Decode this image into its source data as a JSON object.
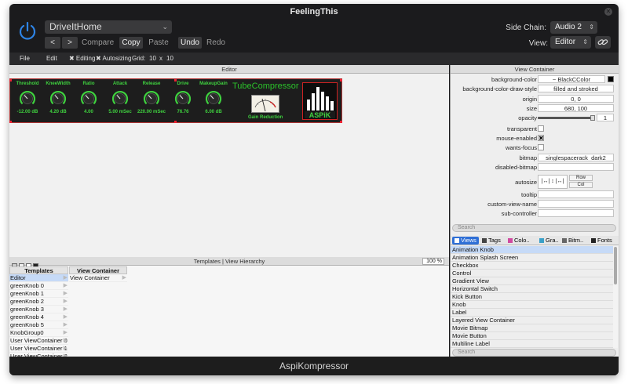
{
  "window_title": "FeelingThis",
  "preset": {
    "name": "DriveItHome"
  },
  "toolbar": {
    "back": "<",
    "forward": ">",
    "compare": "Compare",
    "copy": "Copy",
    "paste": "Paste",
    "undo": "Undo",
    "redo": "Redo",
    "side_chain_label": "Side Chain:",
    "side_chain_value": "Audio 2",
    "view_label": "View:",
    "view_value": "Editor"
  },
  "edit_bar": {
    "file": "File",
    "edit": "Edit",
    "editing": "✖ Editing",
    "autosizing": "✖ Autosizing",
    "grid_label": "Grid:",
    "grid_x": "10",
    "grid_sep": "x",
    "grid_y": "10"
  },
  "editor": {
    "title": "Editor",
    "plugin": {
      "name": "TubeCompressor",
      "knobs": [
        {
          "label": "Threshold",
          "value": "-12.00 dB"
        },
        {
          "label": "KneeWidth",
          "value": "4.20 dB"
        },
        {
          "label": "Ratio",
          "value": "4.00"
        },
        {
          "label": "Attack",
          "value": "5.00 mSec"
        },
        {
          "label": "Release",
          "value": "220.00 mSec"
        },
        {
          "label": "Drive",
          "value": "76.76"
        },
        {
          "label": "MakeupGain",
          "value": "6.00 dB"
        }
      ],
      "meter_label": "Gain Reduction",
      "logo_text": "ASPiK"
    }
  },
  "templates": {
    "title": "Templates | View Hierarchy",
    "zoom": "100 %",
    "col1_header": "Templates",
    "col2_header": "View Container",
    "items": [
      "Editor",
      "greenKnob 0",
      "greenKnob 1",
      "greenKnob 2",
      "greenKnob 3",
      "greenKnob 4",
      "greenKnob 5",
      "KnobGroup0",
      "User ViewContainer 0",
      "User ViewContainer 1",
      "User ViewContainer 2"
    ],
    "hierarchy": [
      "View Container"
    ]
  },
  "view_container": {
    "title": "View Container",
    "attributes": [
      {
        "label": "background-color",
        "value": "~ BlackCColor",
        "kind": "color"
      },
      {
        "label": "background-color-draw-style",
        "value": "filled and stroked",
        "kind": "text"
      },
      {
        "label": "origin",
        "value": "0, 0",
        "kind": "text"
      },
      {
        "label": "size",
        "value": "680, 100",
        "kind": "text"
      },
      {
        "label": "opacity",
        "value": "1",
        "kind": "slider"
      },
      {
        "label": "transparent",
        "value": "",
        "kind": "check"
      },
      {
        "label": "mouse-enabled",
        "value": "✖",
        "kind": "check"
      },
      {
        "label": "wants-focus",
        "value": "",
        "kind": "check"
      },
      {
        "label": "bitmap",
        "value": "singlespacerack_dark2",
        "kind": "text"
      },
      {
        "label": "disabled-bitmap",
        "value": "",
        "kind": "text"
      },
      {
        "label": "autosize",
        "value": "",
        "kind": "autosize"
      },
      {
        "label": "tooltip",
        "value": "",
        "kind": "text"
      },
      {
        "label": "custom-view-name",
        "value": "",
        "kind": "text"
      },
      {
        "label": "sub-controller",
        "value": "",
        "kind": "text"
      }
    ],
    "autosize_row": "Row",
    "autosize_col": "Col",
    "search_placeholder": "Search",
    "tabs": [
      {
        "label": "Views",
        "icon": "views-icon",
        "color": "#2f6fd6"
      },
      {
        "label": "Tags",
        "icon": "tag-icon",
        "color": "#444444"
      },
      {
        "label": "Colo..",
        "icon": "color-wheel-icon",
        "color": "#d04aa0"
      },
      {
        "label": "Gra..",
        "icon": "gradient-icon",
        "color": "#3aa0c8"
      },
      {
        "label": "Bitm..",
        "icon": "bitmap-icon",
        "color": "#666666"
      },
      {
        "label": "Fonts",
        "icon": "font-icon",
        "color": "#222222"
      }
    ],
    "views": [
      "Animation Knob",
      "Animation Splash Screen",
      "Checkbox",
      "Control",
      "Gradient View",
      "Horizontal Switch",
      "Kick Button",
      "Knob",
      "Label",
      "Layered View Container",
      "Movie Bitmap",
      "Movie Button",
      "Multiline Label",
      "OnOff Button"
    ],
    "bottom_search_placeholder": "Search"
  },
  "footer_title": "AspiKompressor",
  "colors": {
    "accent_green": "#3fd13f",
    "selection": "#c6daf7",
    "window_bg": "#1b1b1d"
  }
}
